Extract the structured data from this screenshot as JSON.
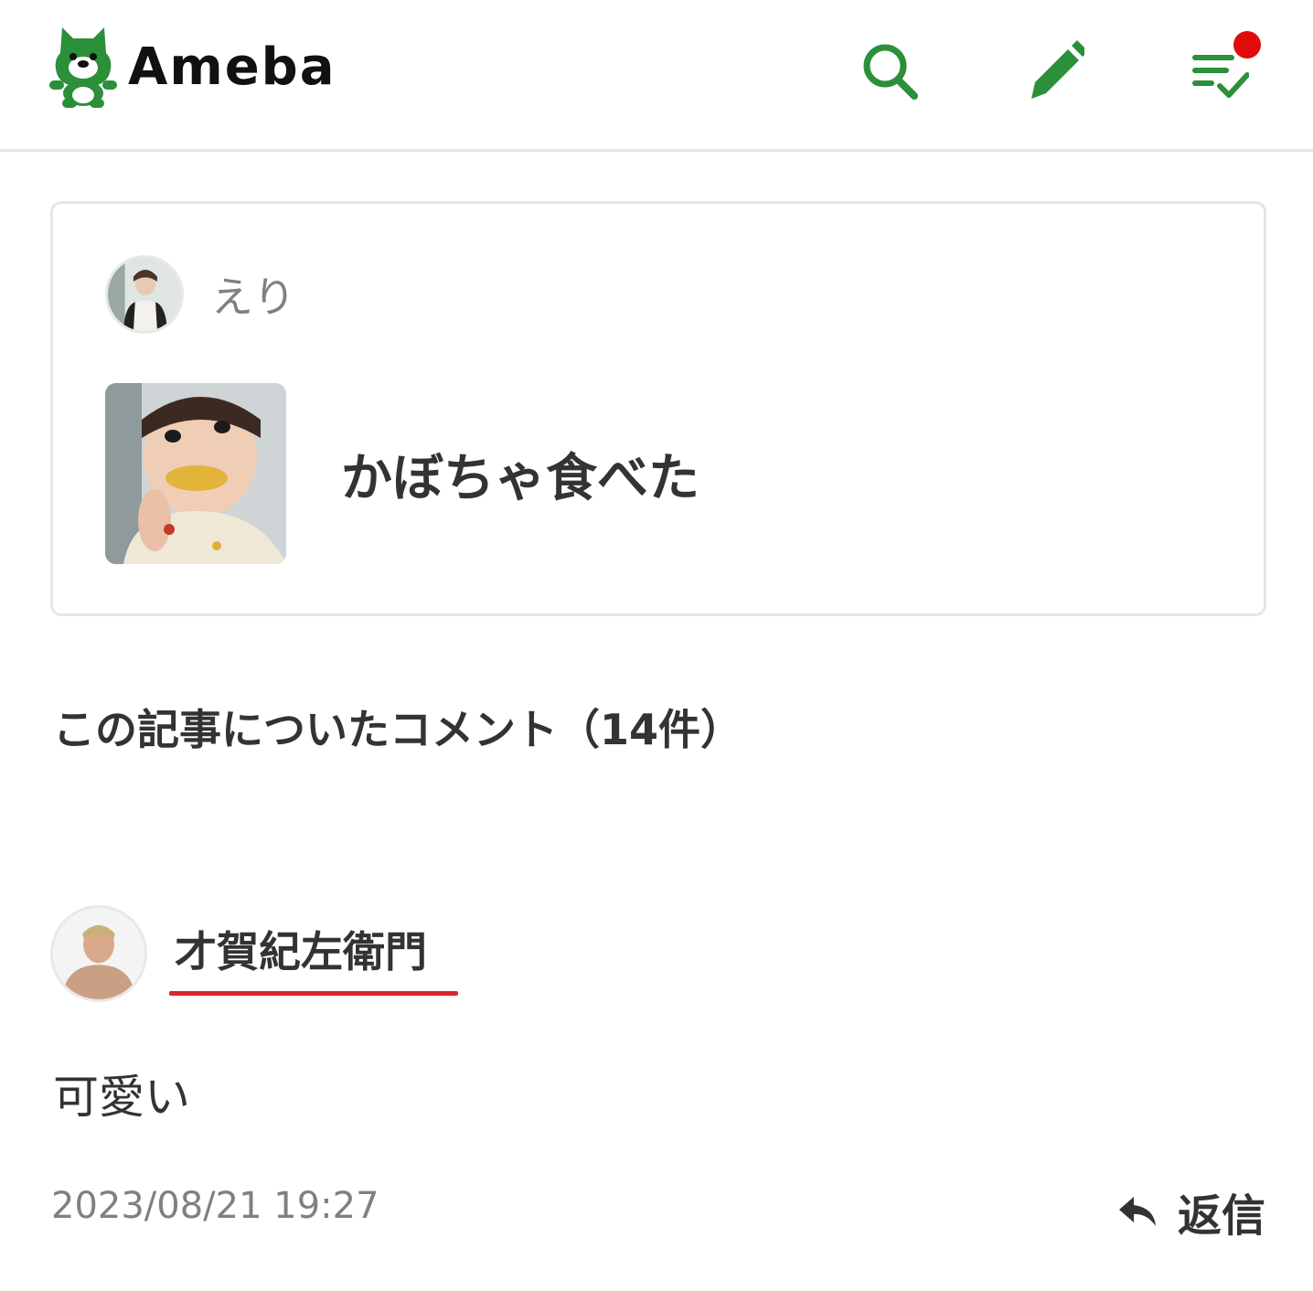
{
  "header": {
    "logo_text": "Ameba",
    "brand_color": "#2c8f3a",
    "notification_dot_color": "#e00b0b",
    "icons": [
      "search-icon",
      "pencil-icon",
      "checklist-icon"
    ]
  },
  "article": {
    "author_name": "えり",
    "title": "かぼちゃ食べた"
  },
  "comments": {
    "heading": "この記事についたコメント（14件）"
  },
  "comment": {
    "author": "才賀紀左衛門",
    "body": "可愛い",
    "timestamp": "2023/08/21 19:27",
    "reply_label": "返信",
    "underline_color": "#d9252b"
  }
}
